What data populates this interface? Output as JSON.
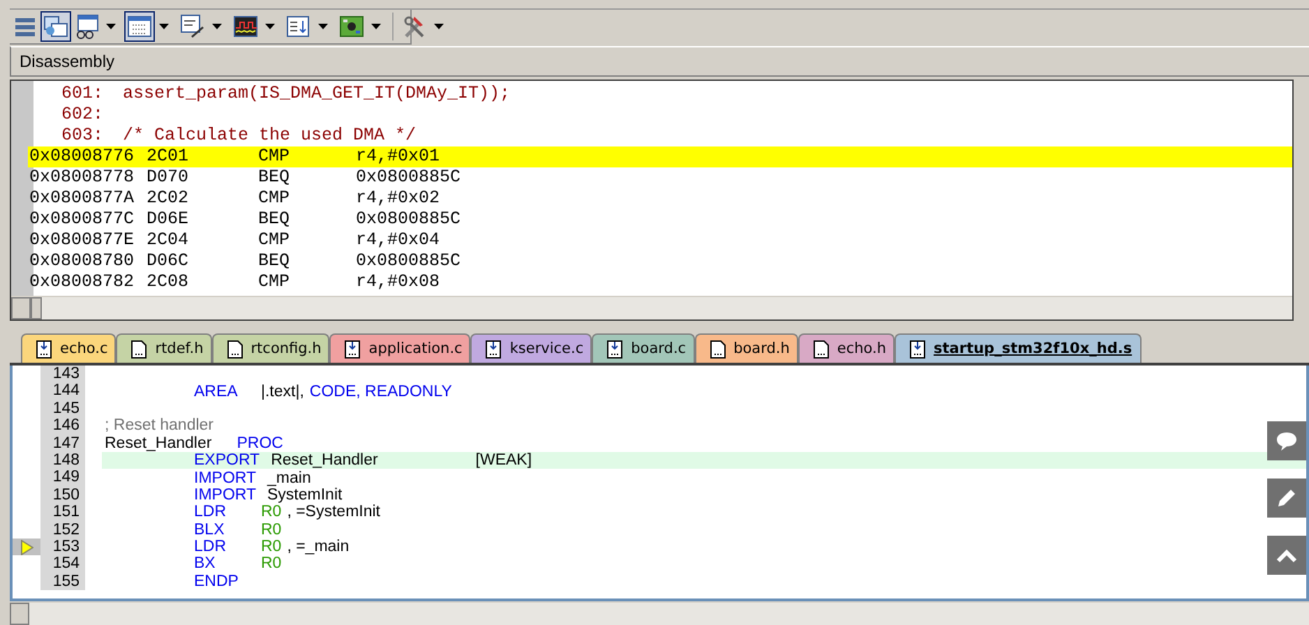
{
  "toolbar": [
    {
      "kind": "list",
      "on": false,
      "dropdown": false
    },
    {
      "kind": "windows",
      "on": true,
      "dropdown": false
    },
    {
      "kind": "watch",
      "on": false,
      "dropdown": true
    },
    {
      "kind": "grid",
      "on": true,
      "dropdown": true
    },
    {
      "kind": "edit",
      "on": false,
      "dropdown": true
    },
    {
      "kind": "analyzer",
      "on": false,
      "dropdown": true
    },
    {
      "kind": "import",
      "on": false,
      "dropdown": true
    },
    {
      "kind": "board",
      "on": false,
      "dropdown": true
    },
    {
      "kind": "tools",
      "on": false,
      "dropdown": true
    }
  ],
  "disassembly": {
    "title": "Disassembly",
    "rows": [
      {
        "kind": "source",
        "number": "601:",
        "text": "assert_param(IS_DMA_GET_IT(DMAy_IT));"
      },
      {
        "kind": "source",
        "number": "602:",
        "text": ""
      },
      {
        "kind": "source",
        "number": "603:",
        "text": "/* Calculate the used DMA */"
      },
      {
        "kind": "instruction",
        "address": "0x08008776",
        "opcode": "2C01",
        "mnemonic": "CMP",
        "operand": "r4,#0x01",
        "selected": true
      },
      {
        "kind": "instruction",
        "address": "0x08008778",
        "opcode": "D070",
        "mnemonic": "BEQ",
        "operand": "0x0800885C",
        "selected": false
      },
      {
        "kind": "instruction",
        "address": "0x0800877A",
        "opcode": "2C02",
        "mnemonic": "CMP",
        "operand": "r4,#0x02",
        "selected": false
      },
      {
        "kind": "instruction",
        "address": "0x0800877C",
        "opcode": "D06E",
        "mnemonic": "BEQ",
        "operand": "0x0800885C",
        "selected": false
      },
      {
        "kind": "instruction",
        "address": "0x0800877E",
        "opcode": "2C04",
        "mnemonic": "CMP",
        "operand": "r4,#0x04",
        "selected": false
      },
      {
        "kind": "instruction",
        "address": "0x08008780",
        "opcode": "D06C",
        "mnemonic": "BEQ",
        "operand": "0x0800885C",
        "selected": false
      },
      {
        "kind": "instruction",
        "address": "0x08008782",
        "opcode": "2C08",
        "mnemonic": "CMP",
        "operand": "r4,#0x08",
        "selected": false
      }
    ]
  },
  "tabs": [
    {
      "label": "echo.c",
      "kind": "arrow",
      "color": "#fbd67c",
      "selected": false
    },
    {
      "label": "rtdef.h",
      "kind": "plain",
      "color": "#c5d3a5",
      "selected": false
    },
    {
      "label": "rtconfig.h",
      "kind": "plain",
      "color": "#c5d3a5",
      "selected": false
    },
    {
      "label": "application.c",
      "kind": "arrow",
      "color": "#f0a0a0",
      "selected": false
    },
    {
      "label": "kservice.c",
      "kind": "arrow",
      "color": "#c0a9e0",
      "selected": false
    },
    {
      "label": "board.c",
      "kind": "arrow",
      "color": "#a2c6b8",
      "selected": false
    },
    {
      "label": "board.h",
      "kind": "plain",
      "color": "#f8b98a",
      "selected": false
    },
    {
      "label": "echo.h",
      "kind": "plain",
      "color": "#d8a9c5",
      "selected": false
    },
    {
      "label": "startup_stm32f10x_hd.s",
      "kind": "arrow",
      "color": "#a9c3d9",
      "selected": true
    }
  ],
  "editor": {
    "lines": [
      {
        "number": "143",
        "highlighted": false,
        "current": false
      },
      {
        "number": "144",
        "op": "AREA",
        "operands": [
          {
            "kind": "plain",
            "text": "|.text|,"
          },
          {
            "kind": "keyword",
            "text": "CODE, READONLY"
          }
        ],
        "highlighted": false,
        "current": false
      },
      {
        "number": "145",
        "highlighted": false,
        "current": false
      },
      {
        "number": "146",
        "label": {
          "kind": "comment",
          "text": "; Reset handler"
        },
        "highlighted": false,
        "current": false
      },
      {
        "number": "147",
        "label": {
          "kind": "plain",
          "text": "Reset_Handler"
        },
        "op": "PROC",
        "highlighted": false,
        "current": false
      },
      {
        "number": "148",
        "op": "EXPORT",
        "operands": [
          {
            "kind": "plain",
            "text": "Reset_Handler"
          },
          {
            "kind": "option",
            "text": "[WEAK]"
          }
        ],
        "highlighted": true,
        "current": false
      },
      {
        "number": "149",
        "op": "IMPORT",
        "operands": [
          {
            "kind": "plain",
            "text": "_main"
          }
        ],
        "highlighted": false,
        "current": false
      },
      {
        "number": "150",
        "op": "IMPORT",
        "operands": [
          {
            "kind": "plain",
            "text": "SystemInit"
          }
        ],
        "highlighted": false,
        "current": false
      },
      {
        "number": "151",
        "op": "LDR",
        "operands": [
          {
            "kind": "register",
            "text": "R0"
          },
          {
            "kind": "plain",
            "text": ", =SystemInit"
          }
        ],
        "highlighted": false,
        "current": false
      },
      {
        "number": "152",
        "op": "BLX",
        "operands": [
          {
            "kind": "register",
            "text": "R0"
          }
        ],
        "highlighted": false,
        "current": false
      },
      {
        "number": "153",
        "op": "LDR",
        "operands": [
          {
            "kind": "register",
            "text": "R0"
          },
          {
            "kind": "plain",
            "text": ", =_main"
          }
        ],
        "highlighted": false,
        "current": true
      },
      {
        "number": "154",
        "op": "BX",
        "operands": [
          {
            "kind": "register",
            "text": "R0"
          }
        ],
        "highlighted": false,
        "current": false
      },
      {
        "number": "155",
        "op": "ENDP",
        "highlighted": false,
        "current": false
      }
    ]
  }
}
